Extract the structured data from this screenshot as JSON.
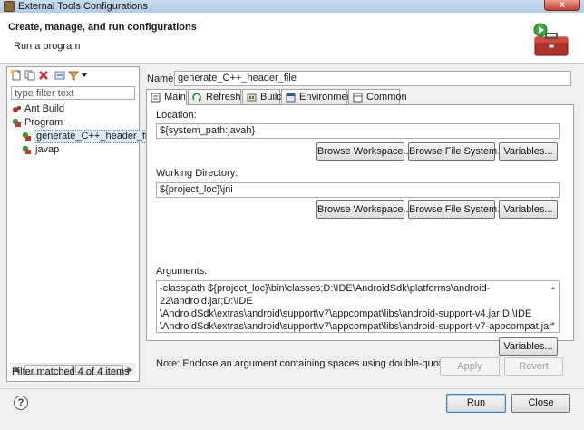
{
  "window": {
    "title": "External Tools Configurations",
    "close_glyph": "x"
  },
  "header": {
    "title": "Create, manage, and run configurations",
    "subtitle": "Run a program"
  },
  "left": {
    "filter_placeholder": "type filter text",
    "tree": [
      {
        "label": "Ant Build",
        "level": 0,
        "icon": "ant-build-icon"
      },
      {
        "label": "Program",
        "level": 0,
        "icon": "program-icon"
      },
      {
        "label": "generate_C++_header_file",
        "level": 1,
        "icon": "program-config-icon",
        "selected": true
      },
      {
        "label": "javap",
        "level": 1,
        "icon": "program-config-icon"
      }
    ],
    "filter_status": "Filter matched 4 of 4 items"
  },
  "right": {
    "name_label": "Name:",
    "name_value": "generate_C++_header_file",
    "tabs": [
      {
        "label": "Main",
        "icon": "main-tab-icon",
        "active": true
      },
      {
        "label": "Refresh",
        "icon": "refresh-icon"
      },
      {
        "label": "Build",
        "icon": "build-icon"
      },
      {
        "label": "Environment",
        "icon": "environment-icon"
      },
      {
        "label": "Common",
        "icon": "common-icon"
      }
    ],
    "location": {
      "label": "Location:",
      "value": "${system_path:javah}",
      "btn_workspace": "Browse Workspace...",
      "btn_filesystem": "Browse File System...",
      "btn_variables": "Variables..."
    },
    "working_dir": {
      "label": "Working Directory:",
      "value": "${project_loc}\\jni",
      "btn_workspace": "Browse Workspace...",
      "btn_filesystem": "Browse File System...",
      "btn_variables": "Variables..."
    },
    "arguments": {
      "label": "Arguments:",
      "value": "-classpath ${project_loc}\\bin\\classes;D:\\IDE\\AndroidSdk\\platforms\\android-22\\android.jar;D:\\IDE\n\\AndroidSdk\\extras\\android\\support\\v7\\appcompat\\libs\\android-support-v4.jar;D:\\IDE\n\\AndroidSdk\\extras\\android\\support\\v7\\appcompat\\libs\\android-support-v7-appcompat.jar -d\n${project_loc}\\jni -jni ${java_type_name}",
      "btn_variables": "Variables..."
    },
    "note": "Note: Enclose an argument containing spaces using double-quotes (\").",
    "apply_label": "Apply",
    "revert_label": "Revert"
  },
  "footer": {
    "help_glyph": "?",
    "run_label": "Run",
    "close_label": "Close"
  },
  "colors": {
    "selection": "#dce9f7",
    "title_bar": "#c9dcef",
    "close_button": "#c4402c"
  }
}
